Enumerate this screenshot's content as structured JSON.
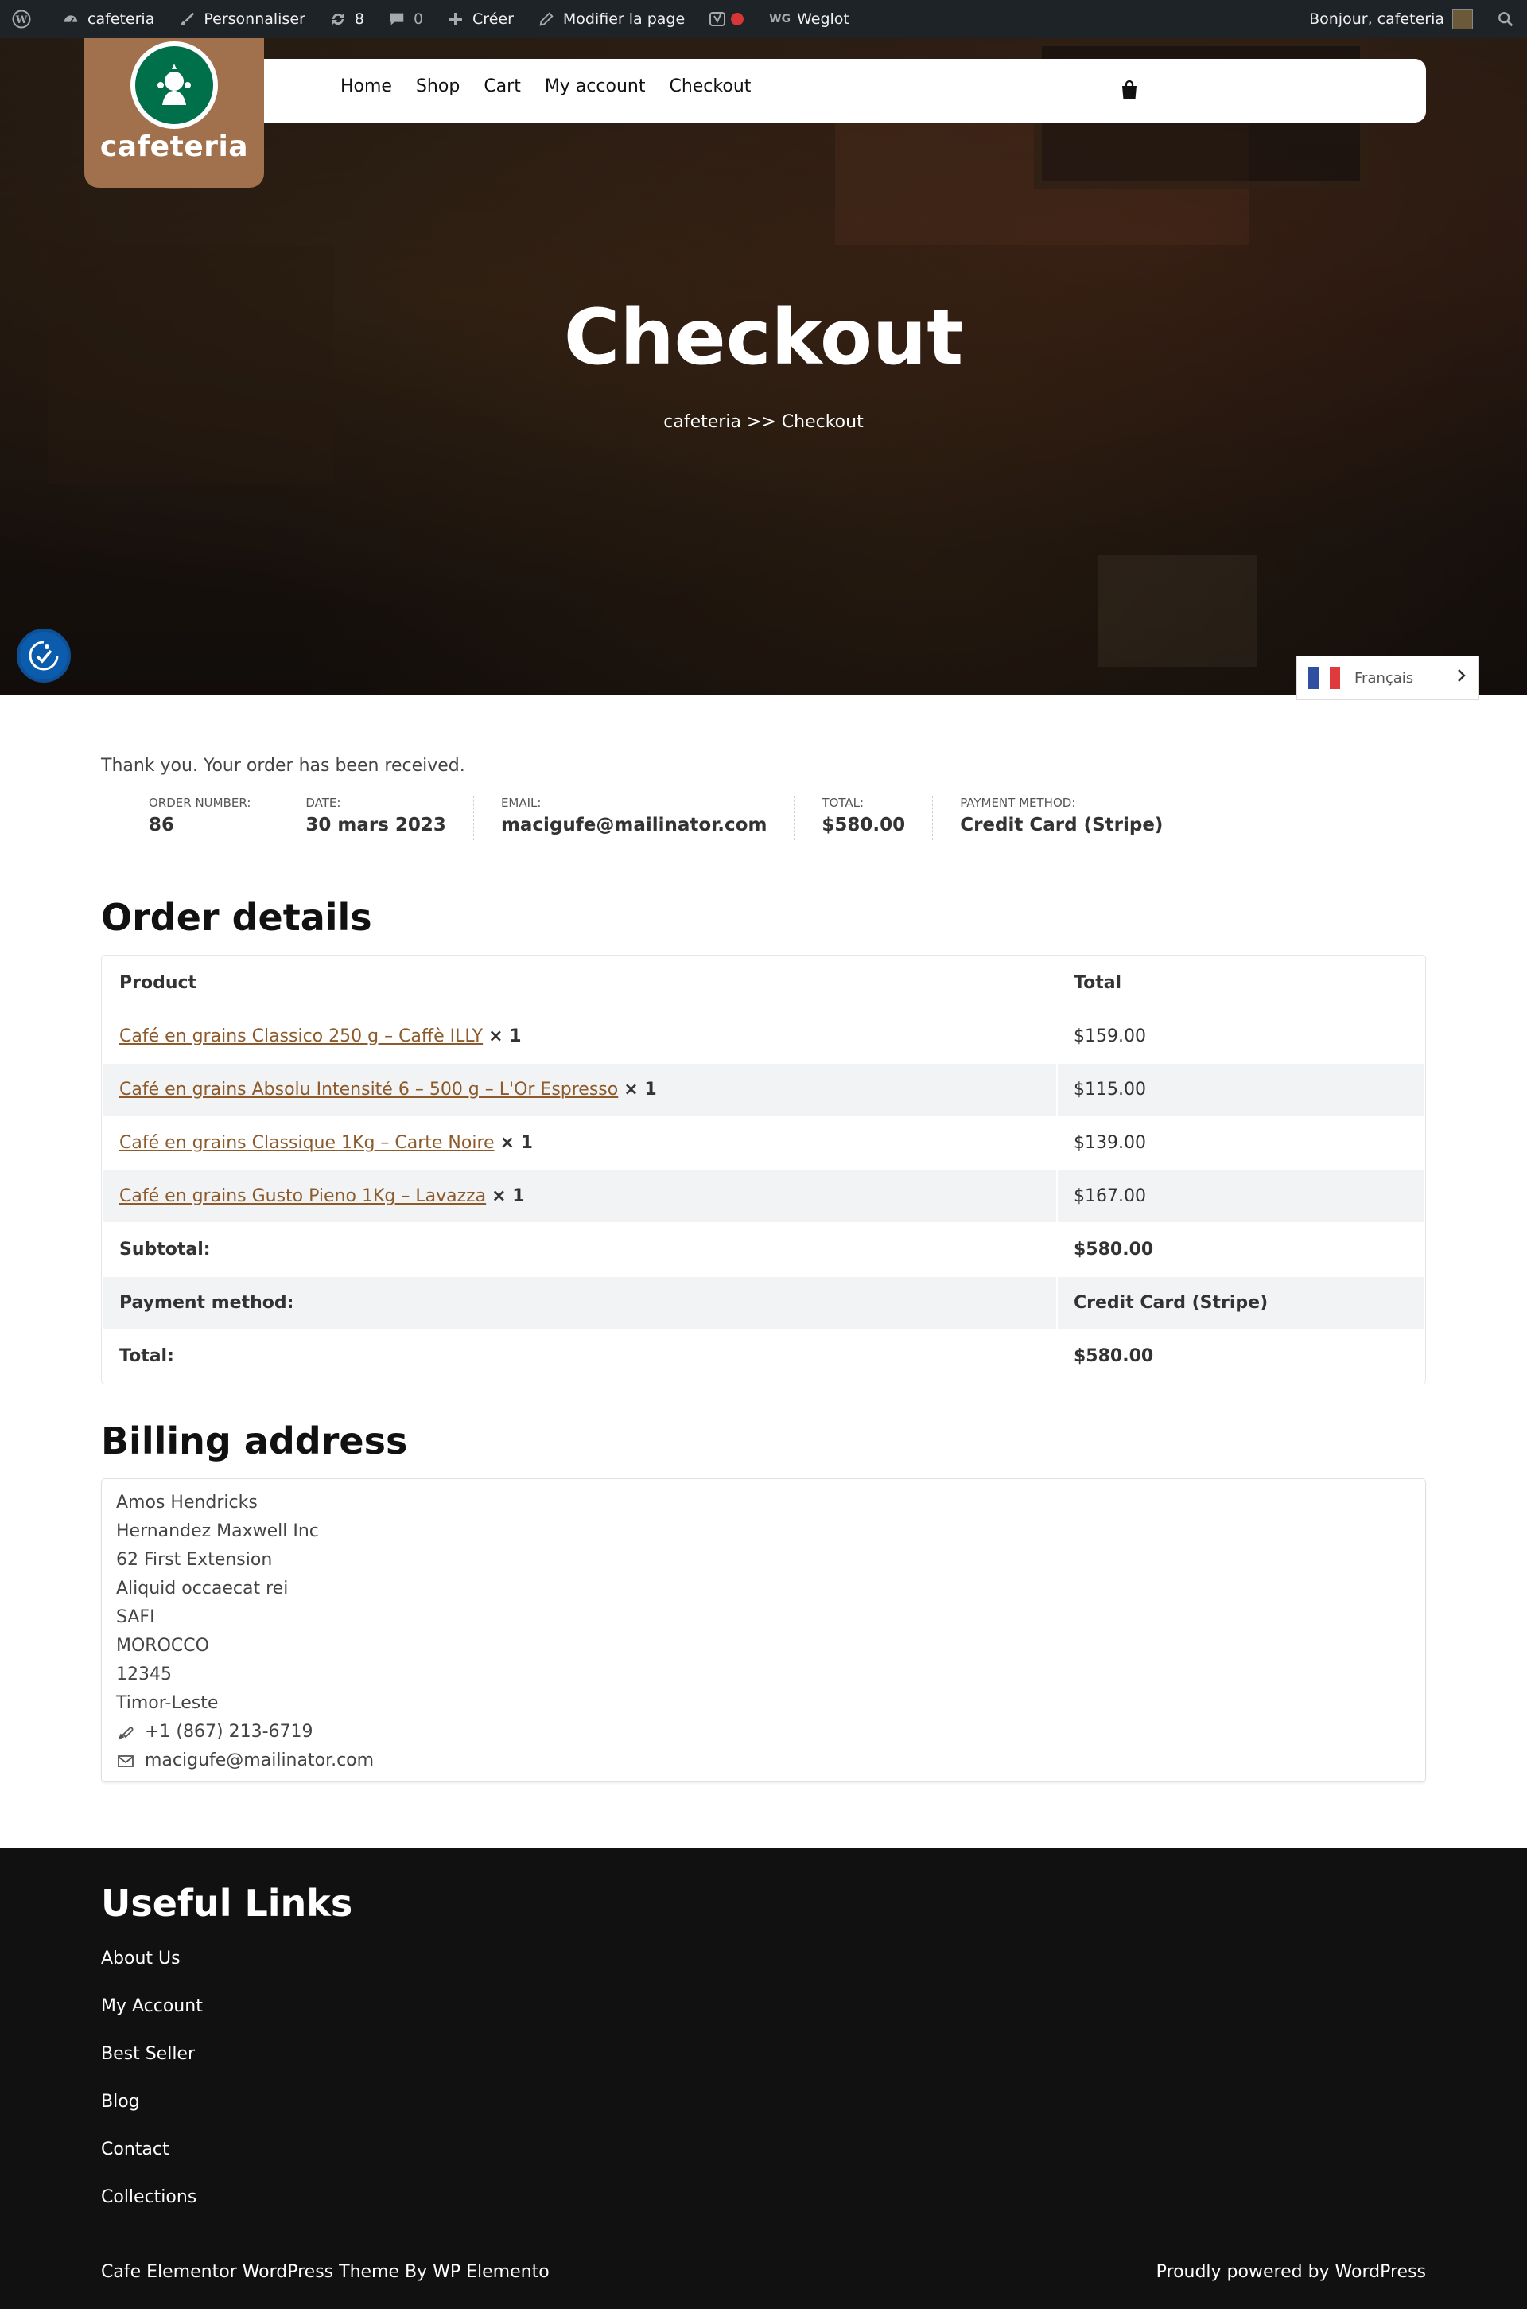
{
  "admin_bar": {
    "site": "cafeteria",
    "customize": "Personnaliser",
    "updates": "8",
    "comments": "0",
    "new": "Créer",
    "edit_page": "Modifier la page",
    "weglot_prefix": "WG",
    "weglot": "Weglot",
    "greeting": "Bonjour, cafeteria"
  },
  "logo": {
    "text": "cafeteria"
  },
  "nav": [
    "Home",
    "Shop",
    "Cart",
    "My account",
    "Checkout"
  ],
  "hero": {
    "title": "Checkout",
    "breadcrumb": "cafeteria >> Checkout"
  },
  "language": {
    "label": "Français",
    "flag_colors": [
      "#2f4fa0",
      "#ffffff",
      "#e03a3e"
    ]
  },
  "order": {
    "thanks": "Thank you. Your order has been received.",
    "overview": [
      {
        "label": "Order number:",
        "value": "86"
      },
      {
        "label": "Date:",
        "value": "30 mars 2023"
      },
      {
        "label": "Email:",
        "value": "macigufe@mailinator.com"
      },
      {
        "label": "Total:",
        "value": "$580.00"
      },
      {
        "label": "Payment method:",
        "value": "Credit Card (Stripe)"
      }
    ]
  },
  "order_details": {
    "title": "Order details",
    "headers": {
      "product": "Product",
      "total": "Total"
    },
    "items": [
      {
        "name": "Café en grains Classico 250 g – Caffè ILLY",
        "qty": "× 1",
        "total": "$159.00"
      },
      {
        "name": "Café en grains Absolu Intensité 6 – 500 g – L'Or Espresso",
        "qty": "× 1",
        "total": "$115.00"
      },
      {
        "name": "Café en grains Classique 1Kg – Carte Noire",
        "qty": "× 1",
        "total": "$139.00"
      },
      {
        "name": "Café en grains Gusto Pieno 1Kg – Lavazza",
        "qty": "× 1",
        "total": "$167.00"
      }
    ],
    "totals": [
      {
        "label": "Subtotal:",
        "value": "$580.00"
      },
      {
        "label": "Payment method:",
        "value": "Credit Card (Stripe)"
      },
      {
        "label": "Total:",
        "value": "$580.00"
      }
    ]
  },
  "billing": {
    "title": "Billing address",
    "lines": [
      "Amos Hendricks",
      "Hernandez Maxwell Inc",
      "62 First Extension",
      "Aliquid occaecat rei",
      "SAFI",
      "MOROCCO",
      "12345",
      "Timor-Leste"
    ],
    "phone": "+1 (867) 213-6719",
    "email": "macigufe@mailinator.com"
  },
  "footer": {
    "title": "Useful Links",
    "links": [
      "About Us",
      "My Account",
      "Best Seller",
      "Blog",
      "Contact",
      "Collections"
    ],
    "credit_left": "Cafe Elementor WordPress Theme By WP Elemento",
    "credit_right": "Proudly powered by WordPress"
  }
}
